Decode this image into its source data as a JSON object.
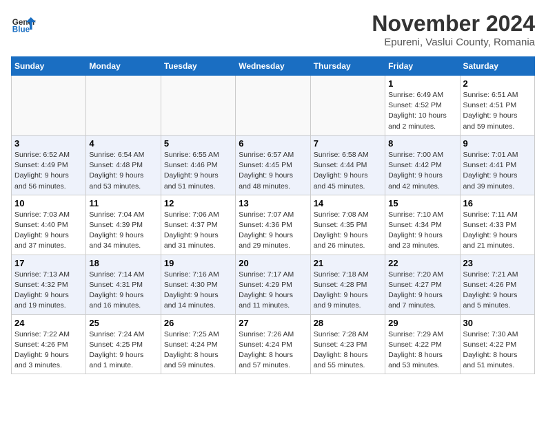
{
  "header": {
    "logo_general": "General",
    "logo_blue": "Blue",
    "month_title": "November 2024",
    "subtitle": "Epureni, Vaslui County, Romania"
  },
  "days_of_week": [
    "Sunday",
    "Monday",
    "Tuesday",
    "Wednesday",
    "Thursday",
    "Friday",
    "Saturday"
  ],
  "weeks": [
    [
      {
        "day": "",
        "info": ""
      },
      {
        "day": "",
        "info": ""
      },
      {
        "day": "",
        "info": ""
      },
      {
        "day": "",
        "info": ""
      },
      {
        "day": "",
        "info": ""
      },
      {
        "day": "1",
        "info": "Sunrise: 6:49 AM\nSunset: 4:52 PM\nDaylight: 10 hours\nand 2 minutes."
      },
      {
        "day": "2",
        "info": "Sunrise: 6:51 AM\nSunset: 4:51 PM\nDaylight: 9 hours\nand 59 minutes."
      }
    ],
    [
      {
        "day": "3",
        "info": "Sunrise: 6:52 AM\nSunset: 4:49 PM\nDaylight: 9 hours\nand 56 minutes."
      },
      {
        "day": "4",
        "info": "Sunrise: 6:54 AM\nSunset: 4:48 PM\nDaylight: 9 hours\nand 53 minutes."
      },
      {
        "day": "5",
        "info": "Sunrise: 6:55 AM\nSunset: 4:46 PM\nDaylight: 9 hours\nand 51 minutes."
      },
      {
        "day": "6",
        "info": "Sunrise: 6:57 AM\nSunset: 4:45 PM\nDaylight: 9 hours\nand 48 minutes."
      },
      {
        "day": "7",
        "info": "Sunrise: 6:58 AM\nSunset: 4:44 PM\nDaylight: 9 hours\nand 45 minutes."
      },
      {
        "day": "8",
        "info": "Sunrise: 7:00 AM\nSunset: 4:42 PM\nDaylight: 9 hours\nand 42 minutes."
      },
      {
        "day": "9",
        "info": "Sunrise: 7:01 AM\nSunset: 4:41 PM\nDaylight: 9 hours\nand 39 minutes."
      }
    ],
    [
      {
        "day": "10",
        "info": "Sunrise: 7:03 AM\nSunset: 4:40 PM\nDaylight: 9 hours\nand 37 minutes."
      },
      {
        "day": "11",
        "info": "Sunrise: 7:04 AM\nSunset: 4:39 PM\nDaylight: 9 hours\nand 34 minutes."
      },
      {
        "day": "12",
        "info": "Sunrise: 7:06 AM\nSunset: 4:37 PM\nDaylight: 9 hours\nand 31 minutes."
      },
      {
        "day": "13",
        "info": "Sunrise: 7:07 AM\nSunset: 4:36 PM\nDaylight: 9 hours\nand 29 minutes."
      },
      {
        "day": "14",
        "info": "Sunrise: 7:08 AM\nSunset: 4:35 PM\nDaylight: 9 hours\nand 26 minutes."
      },
      {
        "day": "15",
        "info": "Sunrise: 7:10 AM\nSunset: 4:34 PM\nDaylight: 9 hours\nand 23 minutes."
      },
      {
        "day": "16",
        "info": "Sunrise: 7:11 AM\nSunset: 4:33 PM\nDaylight: 9 hours\nand 21 minutes."
      }
    ],
    [
      {
        "day": "17",
        "info": "Sunrise: 7:13 AM\nSunset: 4:32 PM\nDaylight: 9 hours\nand 19 minutes."
      },
      {
        "day": "18",
        "info": "Sunrise: 7:14 AM\nSunset: 4:31 PM\nDaylight: 9 hours\nand 16 minutes."
      },
      {
        "day": "19",
        "info": "Sunrise: 7:16 AM\nSunset: 4:30 PM\nDaylight: 9 hours\nand 14 minutes."
      },
      {
        "day": "20",
        "info": "Sunrise: 7:17 AM\nSunset: 4:29 PM\nDaylight: 9 hours\nand 11 minutes."
      },
      {
        "day": "21",
        "info": "Sunrise: 7:18 AM\nSunset: 4:28 PM\nDaylight: 9 hours\nand 9 minutes."
      },
      {
        "day": "22",
        "info": "Sunrise: 7:20 AM\nSunset: 4:27 PM\nDaylight: 9 hours\nand 7 minutes."
      },
      {
        "day": "23",
        "info": "Sunrise: 7:21 AM\nSunset: 4:26 PM\nDaylight: 9 hours\nand 5 minutes."
      }
    ],
    [
      {
        "day": "24",
        "info": "Sunrise: 7:22 AM\nSunset: 4:26 PM\nDaylight: 9 hours\nand 3 minutes."
      },
      {
        "day": "25",
        "info": "Sunrise: 7:24 AM\nSunset: 4:25 PM\nDaylight: 9 hours\nand 1 minute."
      },
      {
        "day": "26",
        "info": "Sunrise: 7:25 AM\nSunset: 4:24 PM\nDaylight: 8 hours\nand 59 minutes."
      },
      {
        "day": "27",
        "info": "Sunrise: 7:26 AM\nSunset: 4:24 PM\nDaylight: 8 hours\nand 57 minutes."
      },
      {
        "day": "28",
        "info": "Sunrise: 7:28 AM\nSunset: 4:23 PM\nDaylight: 8 hours\nand 55 minutes."
      },
      {
        "day": "29",
        "info": "Sunrise: 7:29 AM\nSunset: 4:22 PM\nDaylight: 8 hours\nand 53 minutes."
      },
      {
        "day": "30",
        "info": "Sunrise: 7:30 AM\nSunset: 4:22 PM\nDaylight: 8 hours\nand 51 minutes."
      }
    ]
  ]
}
